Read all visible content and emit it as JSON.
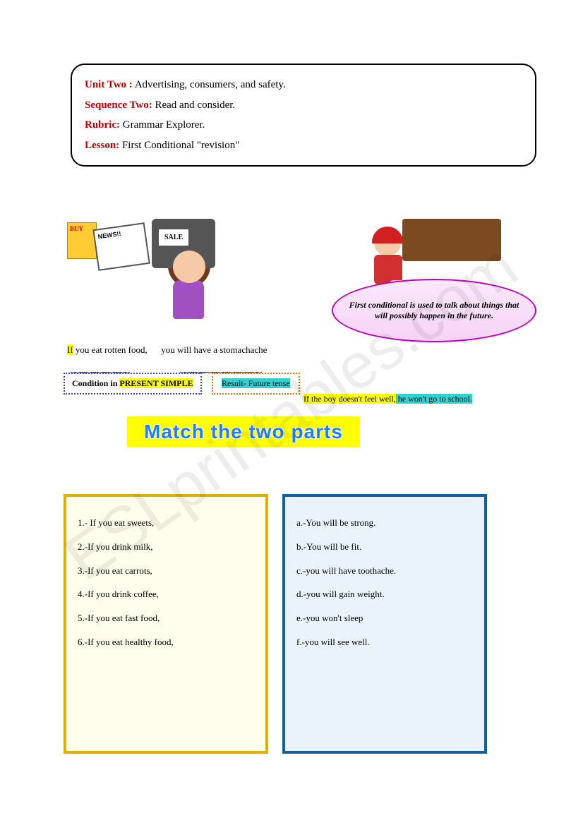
{
  "header": {
    "unit_label": "Unit Two :",
    "unit_value": " Advertising, consumers, and safety.",
    "sequence_label": "Sequence Two:",
    "sequence_value": " Read and consider.",
    "rubric_label": "Rubric:",
    "rubric_value": " Grammar Explorer.",
    "lesson_label": "Lesson:",
    "lesson_value": " First Conditional \"revision\""
  },
  "oval_text": "First conditional is used to talk about things that will possibly happen in the future.",
  "example1": {
    "if_word": "If",
    "condition_rest": " you eat rotten food,",
    "result": "you will have a stomachache"
  },
  "cond_box": {
    "prefix": "Condition",
    "mid": " in ",
    "highlight": "PRESENT SIMPLE"
  },
  "result_box_text": "Result- Future tense",
  "example2": {
    "condition": "If the boy doesn't feel well,",
    "result": " he won't go to school."
  },
  "title": "Match the two parts",
  "left_items": [
    "1.- If you eat sweets,",
    "2.-If you drink milk,",
    "3.-If you eat carrots,",
    "4.-If you drink coffee,",
    "5.-If you eat fast food,",
    "6.-If you eat healthy food,"
  ],
  "right_items": [
    "a.-You will be strong.",
    "b.-You will be fit.",
    "c.-you will have toothache.",
    "d.-you will gain weight.",
    "e.-you won't sleep",
    "f.-you will see well."
  ],
  "watermark": "ESLprintables.com"
}
